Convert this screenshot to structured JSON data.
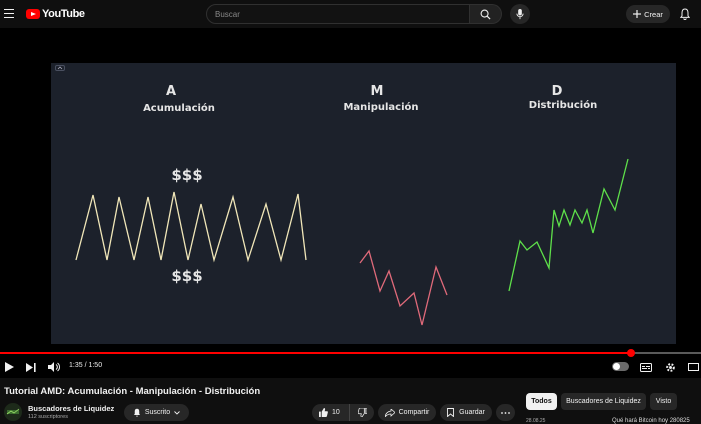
{
  "header": {
    "logo_text": "YouTube",
    "search_placeholder": "Buscar",
    "create_label": "Crear"
  },
  "video": {
    "slide": {
      "phases": [
        {
          "letter": "A",
          "name": "Acumulación"
        },
        {
          "letter": "M",
          "name": "Manipulación"
        },
        {
          "letter": "D",
          "name": "Distribución"
        }
      ],
      "money_top": "$$$",
      "money_bottom": "$$$",
      "line_colors": {
        "accumulation": "#f0e6b8",
        "manipulation": "#e06a7a",
        "distribution": "#5ee04a"
      }
    },
    "player": {
      "time": "1:35 / 1:50",
      "progress": 0.9,
      "progress_color": "#ff0000"
    }
  },
  "info": {
    "title": "Tutorial AMD: Acumulación - Manipulación - Distribución",
    "channel": "Buscadores de Liquidez",
    "subscribers": "112 suscriptores",
    "subscribe_label": "Suscrito",
    "likes": "10",
    "share_label": "Compartir",
    "save_label": "Guardar"
  },
  "chips": [
    {
      "label": "Todos",
      "active": true
    },
    {
      "label": "Buscadores de Liquidez",
      "active": false
    },
    {
      "label": "Visto",
      "active": false
    }
  ],
  "bottom_peek": {
    "date": "28.08.25",
    "next_title": "Qué hará Bitcoin hoy 280825"
  }
}
